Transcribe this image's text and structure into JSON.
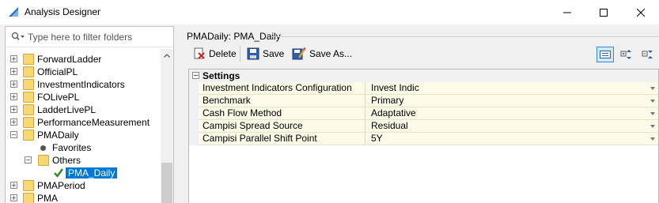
{
  "window": {
    "title": "Analysis Designer"
  },
  "filter": {
    "placeholder": "Type here to filter folders"
  },
  "tree": {
    "items": [
      {
        "label": "ForwardLadder"
      },
      {
        "label": "OfficialPL"
      },
      {
        "label": "InvestmentIndicators"
      },
      {
        "label": "FOLivePL"
      },
      {
        "label": "LadderLivePL"
      },
      {
        "label": "PerformanceMeasurement"
      },
      {
        "label": "PMADaily"
      },
      {
        "label": "Favorites"
      },
      {
        "label": "Others"
      },
      {
        "label": "PMA_Daily"
      },
      {
        "label": "PMAPeriod"
      },
      {
        "label": "PMA"
      }
    ]
  },
  "panel": {
    "title": "PMADaily: PMA_Daily"
  },
  "toolbar": {
    "delete_label": "Delete",
    "save_label": "Save",
    "save_as_label": "Save As..."
  },
  "grid": {
    "category": "Settings",
    "rows": [
      {
        "name": "Investment Indicators Configuration",
        "value": "Invest Indic"
      },
      {
        "name": "Benchmark",
        "value": "Primary"
      },
      {
        "name": "Cash Flow Method",
        "value": "Adaptative"
      },
      {
        "name": "Campisi Spread Source",
        "value": "Residual"
      },
      {
        "name": "Campisi Parallel Shift Point",
        "value": "5Y"
      }
    ]
  },
  "colors": {
    "selection": "#0078d7",
    "folder": "#f7d774",
    "property_bg": "#fbfbe7",
    "checkmark": "#2e8b1e"
  }
}
